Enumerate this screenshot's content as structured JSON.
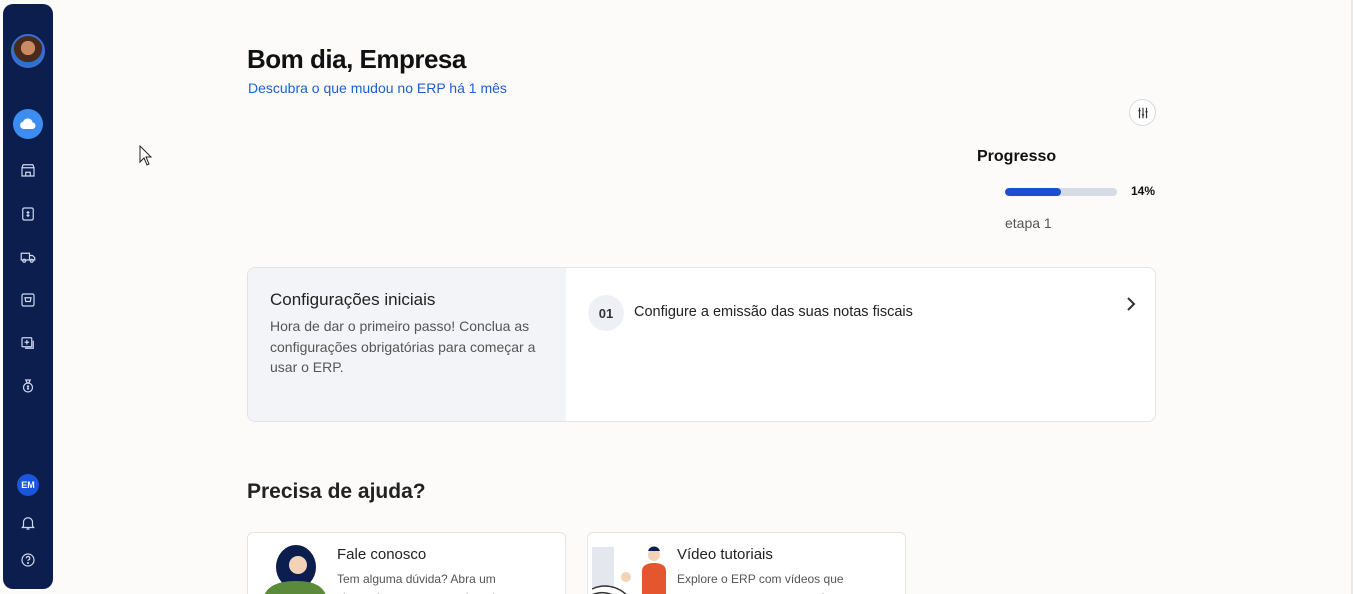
{
  "greeting": {
    "title": "Bom dia, Empresa",
    "subtitle": "Descubra o que mudou no ERP há 1 mês"
  },
  "progress": {
    "title": "Progresso",
    "percent_label": "14%",
    "percent_value": 0.14,
    "step_label": "etapa 1"
  },
  "setup": {
    "title": "Configurações iniciais",
    "description": "Hora de dar o primeiro passo! Conclua as configurações obrigatórias para começar a usar o ERP.",
    "steps": [
      {
        "number": "01",
        "label": "Configure a emissão das suas notas fiscais"
      }
    ]
  },
  "help": {
    "title": "Precisa de ajuda?",
    "cards": [
      {
        "title": "Fale conosco",
        "description": "Tem alguma dúvida? Abra um chamado para o nosso time de"
      },
      {
        "title": "Vídeo tutoriais",
        "description": "Explore o ERP com vídeos que mostram o passo a passo das"
      }
    ]
  },
  "sidebar": {
    "user_initials": "EM",
    "icons": [
      "home-cloud-icon",
      "store-icon",
      "finance-icon",
      "delivery-truck-icon",
      "cart-icon",
      "add-document-icon",
      "money-bag-icon",
      "bell-icon",
      "help-circle-icon"
    ]
  },
  "colors": {
    "sidebar": "#0b1e4e",
    "accent": "#1a56db",
    "link": "#1b5fd1",
    "background": "#fcfbf9"
  }
}
